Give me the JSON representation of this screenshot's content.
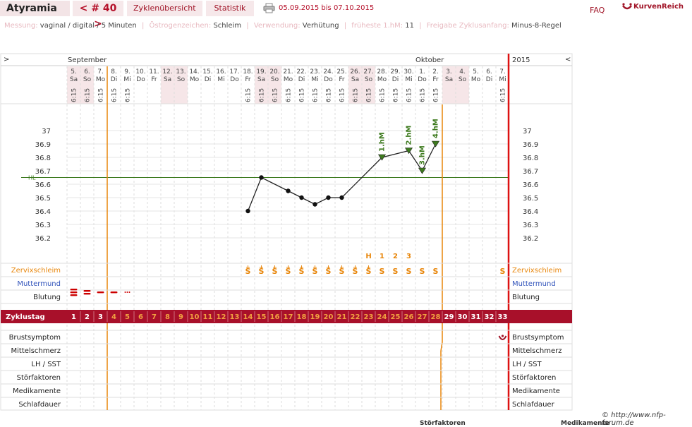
{
  "topbar": {
    "app_title": "Atyramia",
    "cycle_nav": "< # 40 >",
    "tab_overview": "Zyklenübersicht",
    "tab_stats": "Statistik",
    "date_range": "05.09.2015 bis 07.10.2015",
    "faq": "FAQ",
    "brand": "KurvenReich"
  },
  "info": {
    "measure_label": "Messung:",
    "measure_value": "vaginal / digital / 5 Minuten",
    "estrogen_label": "Östrogenzeichen:",
    "estrogen_value": "Schleim",
    "usage_label": "Verwendung:",
    "usage_value": "Verhütung",
    "earliest_label": "früheste 1.hM:",
    "earliest_value": "11",
    "release_label": "Freigabe Zyklusanfang:",
    "release_value": "Minus-8-Regel"
  },
  "chart_data": {
    "type": "line",
    "months": {
      "start": "September",
      "end": "Oktober",
      "year": "2015"
    },
    "nav": {
      "prev": ">",
      "next": "<"
    },
    "days": [
      {
        "date": "5.",
        "wd": "Sa",
        "time": "6:15"
      },
      {
        "date": "6.",
        "wd": "So",
        "time": "6:15"
      },
      {
        "date": "7.",
        "wd": "Mo",
        "time": "6:15"
      },
      {
        "date": "8.",
        "wd": "Di",
        "time": "6:15"
      },
      {
        "date": "9.",
        "wd": "Mi",
        "time": "6:15"
      },
      {
        "date": "10.",
        "wd": "Do",
        "time": ""
      },
      {
        "date": "11.",
        "wd": "Fr",
        "time": ""
      },
      {
        "date": "12.",
        "wd": "Sa",
        "time": ""
      },
      {
        "date": "13.",
        "wd": "So",
        "time": ""
      },
      {
        "date": "14.",
        "wd": "Mo",
        "time": ""
      },
      {
        "date": "15.",
        "wd": "Di",
        "time": ""
      },
      {
        "date": "16.",
        "wd": "Mi",
        "time": ""
      },
      {
        "date": "17.",
        "wd": "Do",
        "time": ""
      },
      {
        "date": "18.",
        "wd": "Fr",
        "time": "6:15"
      },
      {
        "date": "19.",
        "wd": "Sa",
        "time": "6:15"
      },
      {
        "date": "20.",
        "wd": "So",
        "time": "6:15"
      },
      {
        "date": "21.",
        "wd": "Mo",
        "time": "6:15"
      },
      {
        "date": "22.",
        "wd": "Di",
        "time": "6:15"
      },
      {
        "date": "23.",
        "wd": "Mi",
        "time": "6:15"
      },
      {
        "date": "24.",
        "wd": "Do",
        "time": "6:15"
      },
      {
        "date": "25.",
        "wd": "Fr",
        "time": "6:15"
      },
      {
        "date": "26.",
        "wd": "Sa",
        "time": "6:15"
      },
      {
        "date": "27.",
        "wd": "So",
        "time": "6:15"
      },
      {
        "date": "28.",
        "wd": "Mo",
        "time": "6:15"
      },
      {
        "date": "29.",
        "wd": "Di",
        "time": "6:15"
      },
      {
        "date": "30.",
        "wd": "Mi",
        "time": "6:15"
      },
      {
        "date": "1.",
        "wd": "Do",
        "time": "6:15"
      },
      {
        "date": "2.",
        "wd": "Fr",
        "time": "6:15"
      },
      {
        "date": "3.",
        "wd": "Sa",
        "time": ""
      },
      {
        "date": "4.",
        "wd": "So",
        "time": ""
      },
      {
        "date": "5.",
        "wd": "Mo",
        "time": ""
      },
      {
        "date": "6.",
        "wd": "Di",
        "time": ""
      },
      {
        "date": "7.",
        "wd": "Mi",
        "time": "6:15"
      }
    ],
    "weekend_days": [
      1,
      2,
      8,
      9,
      15,
      16,
      22,
      23,
      29,
      30
    ],
    "y_ticks": [
      "37",
      "36.9",
      "36.8",
      "36.7",
      "36.6",
      "36.5",
      "36.4",
      "36.3",
      "36.2"
    ],
    "ylim": [
      36.1,
      37.05
    ],
    "hl_label": "HL",
    "hl_value": 36.65,
    "temps": [
      {
        "day": 14,
        "temp": 36.4
      },
      {
        "day": 15,
        "temp": 36.65
      },
      {
        "day": 17,
        "temp": 36.55
      },
      {
        "day": 18,
        "temp": 36.5
      },
      {
        "day": 19,
        "temp": 36.45
      },
      {
        "day": 20,
        "temp": 36.5
      },
      {
        "day": 21,
        "temp": 36.5
      },
      {
        "day": 24,
        "temp": 36.8
      },
      {
        "day": 26,
        "temp": 36.85
      },
      {
        "day": 27,
        "temp": 36.7
      },
      {
        "day": 28,
        "temp": 36.9
      }
    ],
    "hm_labels": [
      {
        "day": 24,
        "label": "1.hM"
      },
      {
        "day": 26,
        "label": "2.hM"
      },
      {
        "day": 27,
        "label": "3.hM"
      },
      {
        "day": 28,
        "label": "4.hM"
      }
    ],
    "mucus_markers": [
      {
        "day": 23,
        "label": "H"
      },
      {
        "day": 24,
        "label": "1"
      },
      {
        "day": 25,
        "label": "2"
      },
      {
        "day": 26,
        "label": "3"
      }
    ],
    "mucus": [
      {
        "day": 14,
        "sym": "S",
        "plus": true
      },
      {
        "day": 15,
        "sym": "S",
        "plus": true
      },
      {
        "day": 16,
        "sym": "S",
        "plus": true
      },
      {
        "day": 17,
        "sym": "S",
        "plus": true
      },
      {
        "day": 18,
        "sym": "S",
        "plus": true
      },
      {
        "day": 19,
        "sym": "S",
        "plus": true
      },
      {
        "day": 20,
        "sym": "S",
        "plus": true
      },
      {
        "day": 21,
        "sym": "S",
        "plus": true
      },
      {
        "day": 22,
        "sym": "S",
        "plus": true
      },
      {
        "day": 23,
        "sym": "S",
        "plus": true
      },
      {
        "day": 24,
        "sym": "S",
        "plus": false
      },
      {
        "day": 25,
        "sym": "S",
        "plus": false
      },
      {
        "day": 26,
        "sym": "S",
        "plus": false
      },
      {
        "day": 27,
        "sym": "S",
        "plus": false
      },
      {
        "day": 28,
        "sym": "S",
        "plus": false
      },
      {
        "day": 33,
        "sym": "S",
        "plus": false
      }
    ],
    "bleeding": [
      {
        "day": 1,
        "level": 3
      },
      {
        "day": 2,
        "level": 2
      },
      {
        "day": 3,
        "level": 1
      },
      {
        "day": 4,
        "level": 1
      },
      {
        "day": 5,
        "level": 0
      }
    ],
    "rows": [
      "Zervixschleim",
      "Muttermund",
      "Blutung"
    ],
    "cycle_label": "Zyklustag",
    "cycle_days": 33,
    "bottom_rows": [
      "Brustsymptom",
      "Mittelschmerz",
      "LH / SST",
      "Störfaktoren",
      "Medikamente",
      "Schlafdauer"
    ],
    "breast_symbol_day": 33,
    "infertile_end_day": 3,
    "infertile_start_day": 29
  },
  "footer": {
    "copyright": "© http://www.nfp-forum.de",
    "cut_left": "Störfaktoren",
    "cut_right": "Medikamente"
  },
  "colors": {
    "accent": "#a8102a",
    "orange": "#e8860a",
    "green": "#3d7a1e",
    "blue": "#3355bb"
  }
}
